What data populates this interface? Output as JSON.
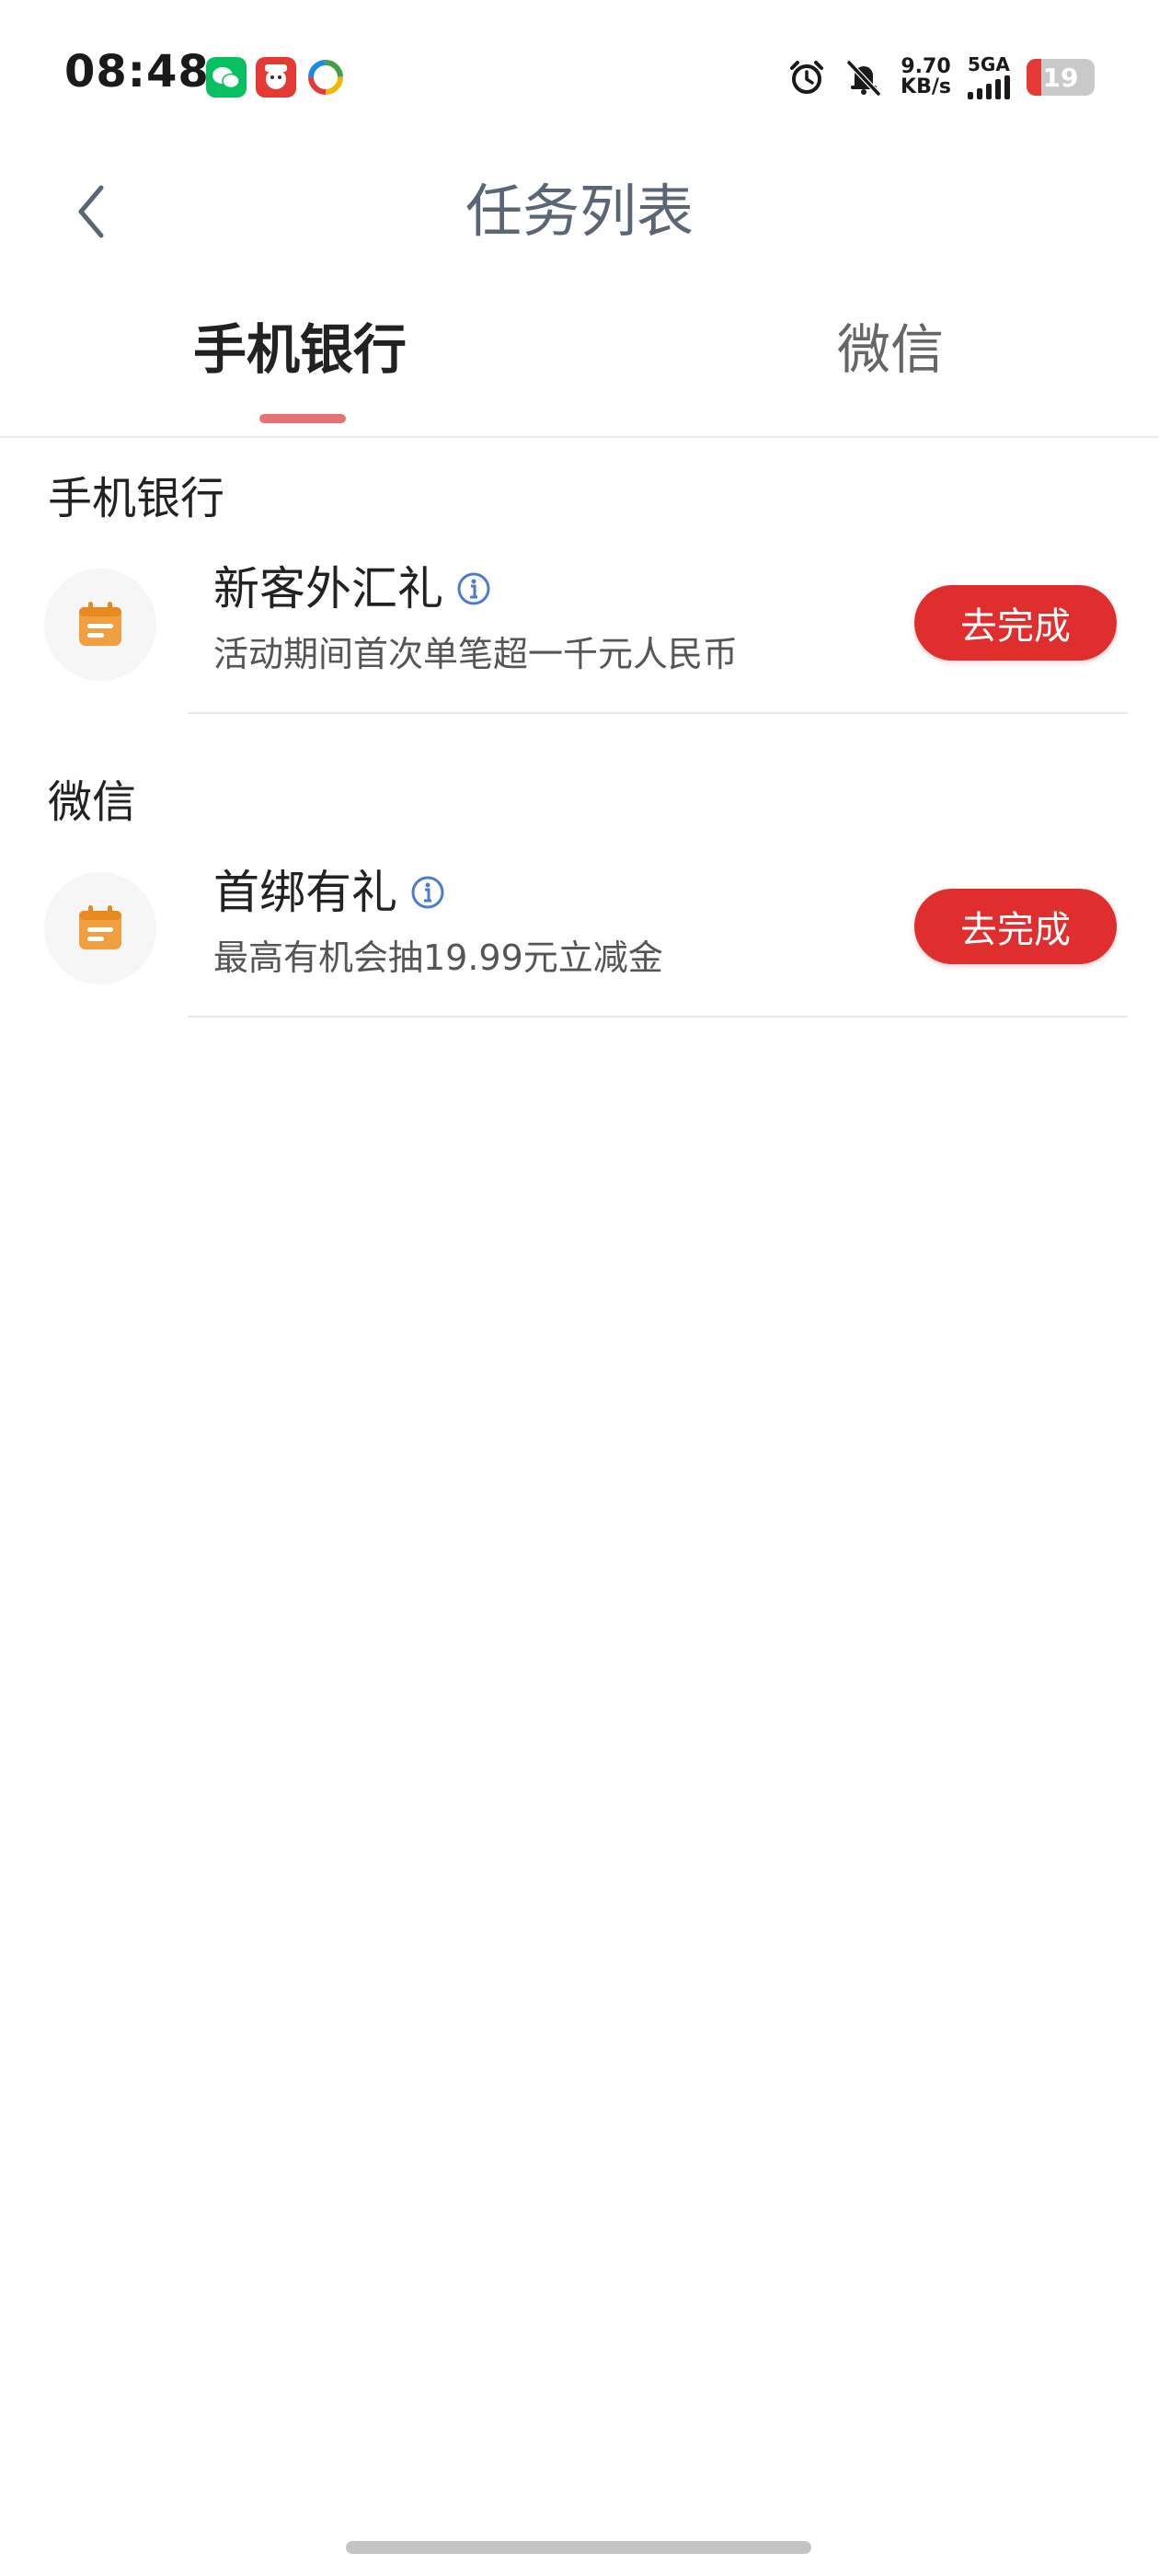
{
  "status_bar": {
    "time": "08:48",
    "net_speed_value": "9.70",
    "net_speed_unit": "KB/s",
    "network_type": "5GA",
    "battery_level": "19",
    "battery_color": "#e53935"
  },
  "header": {
    "title": "任务列表"
  },
  "tabs": [
    {
      "label": "手机银行",
      "active": true
    },
    {
      "label": "微信",
      "active": false
    }
  ],
  "sections": [
    {
      "title": "手机银行",
      "tasks": [
        {
          "name": "新客外汇礼",
          "description": "活动期间首次单笔超一千元人民币",
          "button_label": "去完成",
          "icon": "calendar-icon"
        }
      ]
    },
    {
      "title": "微信",
      "tasks": [
        {
          "name": "首绑有礼",
          "description": "最高有机会抽19.99元立减金",
          "button_label": "去完成",
          "icon": "calendar-icon"
        }
      ]
    }
  ],
  "colors": {
    "accent_red": "#e02e2e",
    "tab_indicator": "#e57373",
    "icon_orange": "#f0a040",
    "info_blue": "#4a7bd0"
  }
}
